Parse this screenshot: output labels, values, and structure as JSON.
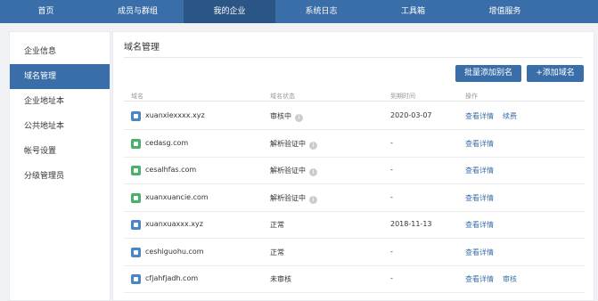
{
  "nav": {
    "items": [
      "首页",
      "成员与群组",
      "我的企业",
      "系统日志",
      "工具箱",
      "增值服务"
    ],
    "active_index": 2
  },
  "sidebar": {
    "items": [
      "企业信息",
      "域名管理",
      "企业地址本",
      "公共地址本",
      "帐号设置",
      "分级管理员"
    ],
    "active_index": 1
  },
  "main": {
    "title": "域名管理",
    "batch_add_label": "批量添加别名",
    "add_label": "+添加域名"
  },
  "table": {
    "headers": [
      "域名",
      "域名状态",
      "到期时间",
      "操作"
    ],
    "rows": [
      {
        "domain": "xuanxiexxxx.xyz",
        "icon": "domain-blue-icon",
        "icon_color": "#4a86c5",
        "status": "审核中",
        "info": true,
        "expire": "2020-03-07",
        "actions": [
          "查看详情",
          "续费"
        ]
      },
      {
        "domain": "cedasg.com",
        "icon": "domain-green-icon",
        "icon_color": "#4caf6a",
        "status": "解析验证中",
        "info": true,
        "expire": "-",
        "actions": [
          "查看详情"
        ]
      },
      {
        "domain": "cesalhfas.com",
        "icon": "domain-green-icon",
        "icon_color": "#4caf6a",
        "status": "解析验证中",
        "info": true,
        "expire": "-",
        "actions": [
          "查看详情"
        ]
      },
      {
        "domain": "xuanxuancie.com",
        "icon": "domain-green-icon",
        "icon_color": "#4caf6a",
        "status": "解析验证中",
        "info": true,
        "expire": "-",
        "actions": [
          "查看详情"
        ]
      },
      {
        "domain": "xuanxuaxxx.xyz",
        "icon": "domain-blue-icon",
        "icon_color": "#4a86c5",
        "status": "正常",
        "info": false,
        "expire": "2018-11-13",
        "actions": [
          "查看详情"
        ]
      },
      {
        "domain": "ceshiguohu.com",
        "icon": "domain-blue-icon",
        "icon_color": "#4a86c5",
        "status": "正常",
        "info": false,
        "expire": "-",
        "actions": [
          "查看详情"
        ]
      },
      {
        "domain": "cfjahfjadh.com",
        "icon": "domain-blue-icon",
        "icon_color": "#4a86c5",
        "status": "未审核",
        "info": false,
        "expire": "-",
        "actions": [
          "查看详情",
          "审核"
        ]
      }
    ]
  },
  "colors": {
    "primary": "#3a6ea8",
    "nav_active": "#2a5585"
  }
}
